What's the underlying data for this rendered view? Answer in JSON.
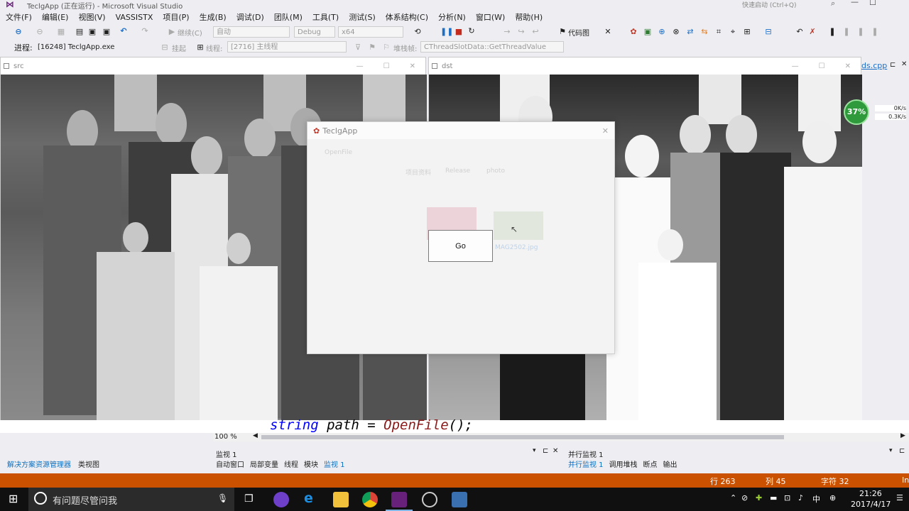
{
  "app": {
    "title": "TeclgApp (正在运行) - Microsoft Visual Studio",
    "quick_launch": "快速启动 (Ctrl+Q)"
  },
  "menu": [
    "文件(F)",
    "编辑(E)",
    "视图(V)",
    "VASSISTX",
    "项目(P)",
    "生成(B)",
    "调试(D)",
    "团队(M)",
    "工具(T)",
    "测试(S)",
    "体系结构(C)",
    "分析(N)",
    "窗口(W)",
    "帮助(H)"
  ],
  "toolbar": {
    "continue_label": "继续(C)",
    "config_auto": "自动",
    "config_debug": "Debug",
    "platform": "x64",
    "code_map": "代码图",
    "process_label": "进程:",
    "process_value": "[16248] TeclgApp.exe",
    "suspend_label": "挂起",
    "thread_label": "线程:",
    "thread_value": "[2716] 主线程",
    "stack_label": "堆栈帧:",
    "stack_value": "CThreadSlotData::GetThreadValue"
  },
  "windows": {
    "src_title": "src",
    "dst_title": "dst",
    "right_tab": "ds.cpp"
  },
  "net": {
    "percent": "37%",
    "up": "0K/s",
    "down": "0.3K/s"
  },
  "dialog": {
    "title": "TeclgApp",
    "go_label": "Go",
    "faded_title": "OpenFile",
    "faded_crumbs": [
      "项目资料",
      "Release",
      "photo"
    ],
    "faded_file1": "MAG2502.jpg",
    "faded_file2": "MAG2502.jpg"
  },
  "editor": {
    "zoom": "100 %",
    "code_keyword": "string",
    "code_rest": " path = ",
    "code_call": "OpenFile",
    "code_end": "();"
  },
  "panels": {
    "left_tabs": [
      "解决方案资源管理器",
      "类视图"
    ],
    "watch_title": "监视 1",
    "watch_tabs": [
      "自动窗口",
      "局部变量",
      "线程",
      "模块",
      "监视 1"
    ],
    "parallel_title": "并行监视 1",
    "parallel_tabs": [
      "并行监视 1",
      "调用堆栈",
      "断点",
      "输出"
    ]
  },
  "status": {
    "line": "行 263",
    "col": "列 45",
    "char": "字符 32",
    "ins": "Ins"
  },
  "taskbar": {
    "search": "有问题尽管问我",
    "time": "21:26",
    "date": "2017/4/17"
  },
  "colors": {
    "vs_purple": "#68217a",
    "status_orange": "#ca5100",
    "accent_blue": "#007acc"
  }
}
